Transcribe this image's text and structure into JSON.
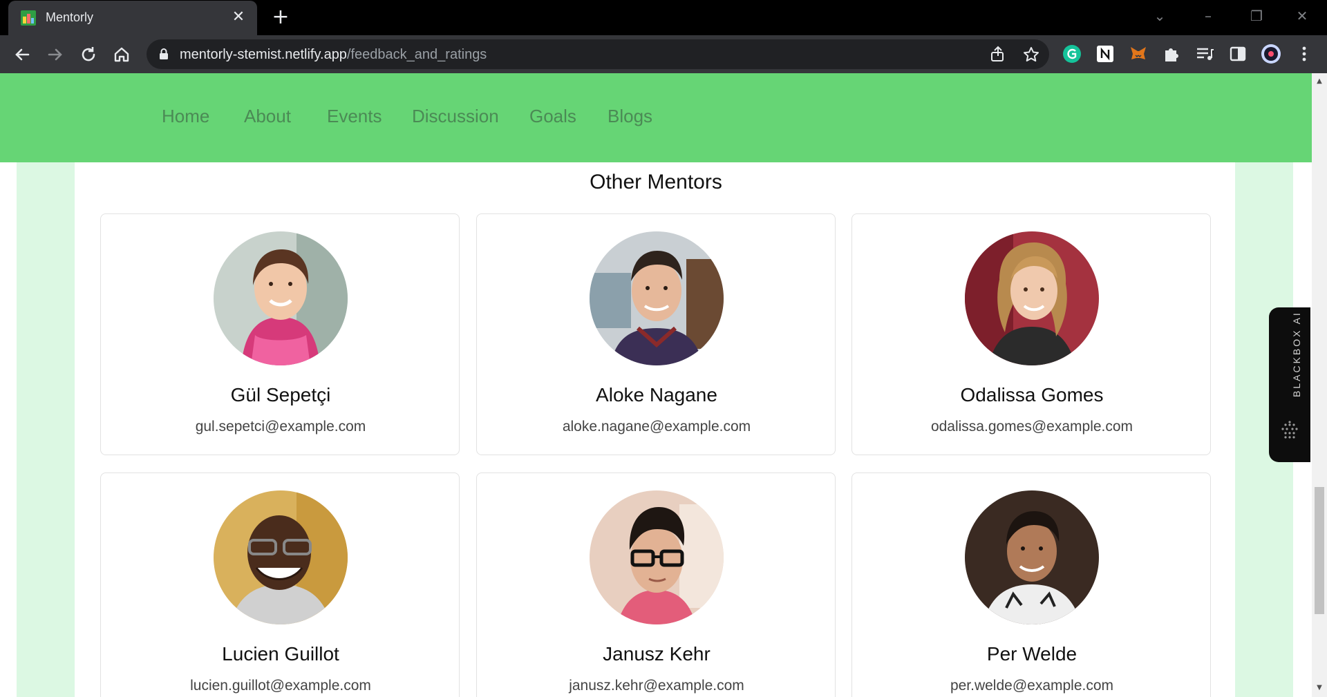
{
  "browser": {
    "tab_title": "Mentorly",
    "tab_close": "✕",
    "new_tab": "+",
    "url_domain": "mentorly-stemist.netlify.app",
    "url_path": "/feedback_and_ratings"
  },
  "nav": {
    "links": [
      "Home",
      "About",
      "Events",
      "Discussion",
      "Goals",
      "Blogs"
    ]
  },
  "section": {
    "title": "Other Mentors"
  },
  "mentors": [
    {
      "name": "Gül Sepetçi",
      "email": "gul.sepetci@example.com"
    },
    {
      "name": "Aloke Nagane",
      "email": "aloke.nagane@example.com"
    },
    {
      "name": "Odalissa Gomes",
      "email": "odalissa.gomes@example.com"
    },
    {
      "name": "Lucien Guillot",
      "email": "lucien.guillot@example.com"
    },
    {
      "name": "Janusz Kehr",
      "email": "janusz.kehr@example.com"
    },
    {
      "name": "Per Welde",
      "email": "per.welde@example.com"
    }
  ],
  "widget": {
    "label": "BLACKBOX AI"
  },
  "colors": {
    "navbar": "#66d575",
    "nav_link": "#4b8a55",
    "page_background": "#dcf8e3"
  }
}
